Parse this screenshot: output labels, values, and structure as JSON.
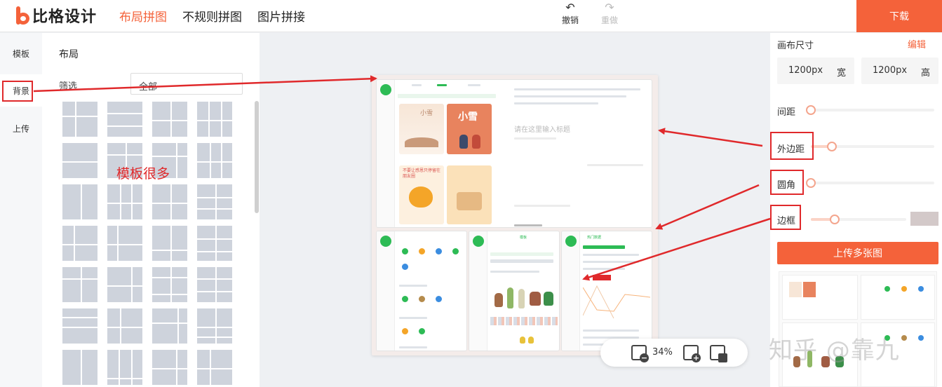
{
  "app": {
    "logo_text": "比格设计"
  },
  "nav": {
    "tabs": [
      {
        "label": "布局拼图",
        "active": true
      },
      {
        "label": "不规则拼图",
        "active": false
      },
      {
        "label": "图片拼接",
        "active": false
      }
    ]
  },
  "toolbar": {
    "undo_label": "撤销",
    "redo_label": "重做",
    "download_label": "下载"
  },
  "rail": {
    "items": [
      {
        "label": "模板",
        "active": false
      },
      {
        "label": "背景",
        "active": true
      },
      {
        "label": "上传",
        "active": false
      }
    ]
  },
  "left_panel": {
    "title": "布局",
    "filter_label": "筛选",
    "filter_value": "全部"
  },
  "annotations": {
    "many_templates": "模板很多"
  },
  "canvas": {
    "zoom": "34%",
    "placeholder_title": "请在这里输入标题",
    "screenshot_labels": {
      "snow_card_title": "小雪",
      "snow_card_big": "小雪",
      "cake_card_title": "不要让感恩只停留在朋友圈",
      "mid_tab": "模板",
      "right_tab": "热门数据"
    }
  },
  "right_panel": {
    "canvas_size_label": "画布尺寸",
    "edit_label": "编辑",
    "width_value": "1200px",
    "width_unit": "宽",
    "height_value": "1200px",
    "height_unit": "高",
    "sliders": [
      {
        "label": "间距",
        "value": 0.0
      },
      {
        "label": "外边距",
        "value": 0.17
      },
      {
        "label": "圆角",
        "value": 0.0
      },
      {
        "label": "边框",
        "value": 0.25
      }
    ],
    "upload_label": "上传多张图"
  },
  "watermark": "知乎 @靠九",
  "colors": {
    "accent": "#f4623a",
    "annotation_red": "#e0292b",
    "brand_green": "#2dbb55",
    "border_swatch": "#d3c9c9"
  }
}
